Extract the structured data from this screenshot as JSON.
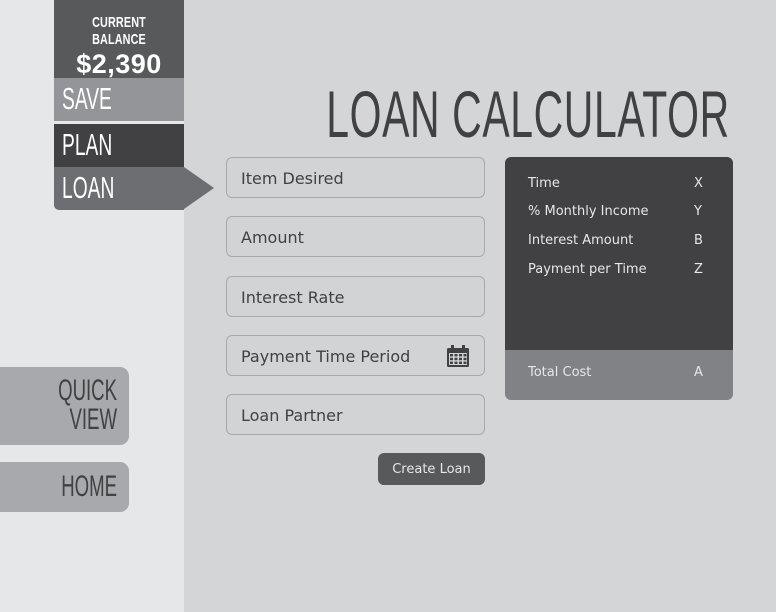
{
  "balance": {
    "label": "CURRENT BALANCE",
    "amount": "$2,390"
  },
  "nav": {
    "save": "SAVE",
    "plan": "PLAN",
    "loan": "LOAN"
  },
  "side": {
    "quick_view_line1": "QUICK",
    "quick_view_line2": "VIEW",
    "home": "HOME"
  },
  "title": "LOAN CALCULATOR",
  "form": {
    "item_desired": "Item Desired",
    "amount": "Amount",
    "interest_rate": "Interest Rate",
    "payment_time_period": "Payment Time Period",
    "loan_partner": "Loan Partner",
    "create_button": "Create Loan"
  },
  "summary": {
    "rows": [
      {
        "label": "Time",
        "value": "X"
      },
      {
        "label": "% Monthly Income",
        "value": "Y"
      },
      {
        "label": "Interest Amount",
        "value": "B"
      },
      {
        "label": "Payment per Time",
        "value": "Z"
      }
    ],
    "total": {
      "label": "Total Cost",
      "value": "A"
    }
  },
  "icons": {
    "date_picker": "calendar-icon"
  },
  "colors": {
    "dark": "#414042",
    "mid": "#58595b",
    "light": "#a7a9ac",
    "bg": "#d4d5d7"
  }
}
